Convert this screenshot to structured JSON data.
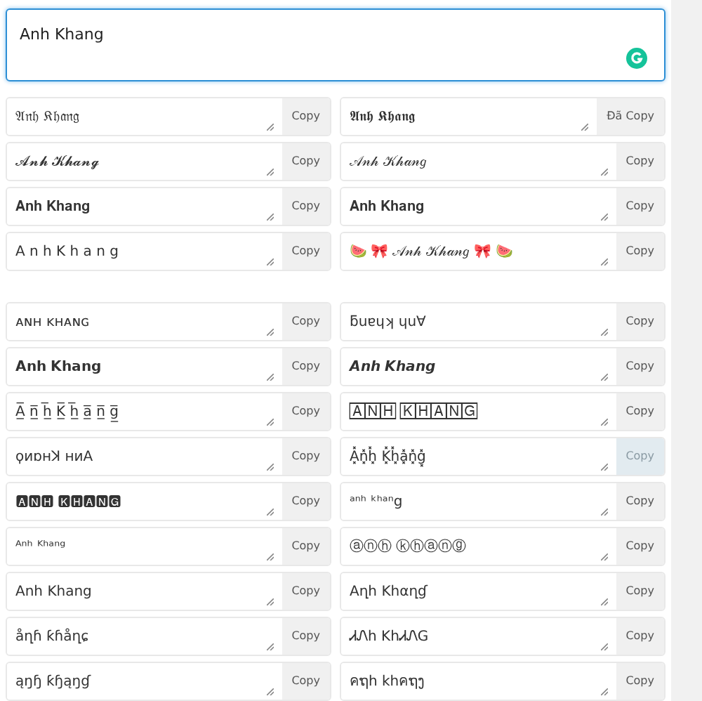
{
  "input": {
    "value": "Anh Khang"
  },
  "groups": [
    {
      "rows": [
        [
          {
            "text": "𝔄𝔫𝔥 𝔎𝔥𝔞𝔫𝔤",
            "button": "Copy",
            "highlighted": false
          },
          {
            "text": "𝕬𝖓𝖍 𝕶𝖍𝖆𝖓𝖌",
            "button": "Đã Copy",
            "highlighted": false
          }
        ],
        [
          {
            "text": "𝓐𝓷𝓱 𝓚𝓱𝓪𝓷𝓰",
            "button": "Copy",
            "highlighted": false
          },
          {
            "text": "𝒜𝓃𝒽 𝒦𝒽𝒶𝓃𝑔",
            "button": "Copy",
            "highlighted": false
          }
        ],
        [
          {
            "text": "𝐀𝐧𝐡 𝐊𝐡𝐚𝐧𝐠",
            "button": "Copy",
            "highlighted": false
          },
          {
            "text": "𝐀𝐧𝐡 𝐊𝐡𝐚𝐧𝐠",
            "button": "Copy",
            "highlighted": false
          }
        ],
        [
          {
            "text": "A n h  K h a n g",
            "button": "Copy",
            "highlighted": false
          },
          {
            "text": "🍉 🎀 𝒜𝓃𝒽 𝒦𝒽𝒶𝓃𝑔 🎀 🍉",
            "button": "Copy",
            "highlighted": false
          }
        ]
      ]
    },
    {
      "rows": [
        [
          {
            "text": "ᴀɴʜ ᴋʜᴀɴɢ",
            "button": "Copy",
            "highlighted": false
          },
          {
            "text": "ƃuɐɥʞ ɥu∀",
            "button": "Copy",
            "highlighted": false
          }
        ],
        [
          {
            "text": "𝗔𝗻𝗵 𝗞𝗵𝗮𝗻𝗴",
            "button": "Copy",
            "highlighted": false
          },
          {
            "text": "𝘼𝙣𝙝 𝙆𝙝𝙖𝙣𝙜",
            "button": "Copy",
            "highlighted": false
          }
        ],
        [
          {
            "text": "A̲̅ n̲̅ h̲̅  K̲̅ h̲̅ a̲̅ n̲̅ g̲̅",
            "button": "Copy",
            "highlighted": false
          },
          {
            "text": "🄰🄽🄷 🄺🄷🄰🄽🄶",
            "button": "Copy",
            "highlighted": false
          }
        ],
        [
          {
            "text": "ϙиɒнꓘ ниA",
            "button": "Copy",
            "highlighted": false
          },
          {
            "text": "A͓̽n͓̽h͓̽ K͓̽h͓̽a͓̽n͓̽g͓̽",
            "button": "Copy",
            "highlighted": true
          }
        ],
        [
          {
            "text": "🅰🅽🅷 🅺🅷🅰🅽🅶",
            "button": "Copy",
            "highlighted": false
          },
          {
            "text": "ᵃⁿʰ ᵏʰᵃⁿg",
            "button": "Copy",
            "highlighted": false
          }
        ],
        [
          {
            "text": "ᴬⁿʰ ᴷʰᵃⁿᵍ",
            "button": "Copy",
            "highlighted": false
          },
          {
            "text": "ⓐⓝⓗ ⓚⓗⓐⓝⓖ",
            "button": "Copy",
            "highlighted": false
          }
        ],
        [
          {
            "text": "Anh Khang",
            "button": "Copy",
            "highlighted": false
          },
          {
            "text": "Aղհ Kհαղɠ",
            "button": "Copy",
            "highlighted": false
          }
        ],
        [
          {
            "text": "åղɦ ƙɦåղɕ",
            "button": "Copy",
            "highlighted": false
          },
          {
            "text": "ᏗᏁh KhᏗᏁG",
            "button": "Copy",
            "highlighted": false
          }
        ],
        [
          {
            "text": "ąŋɧ ƙɧąŋɠ",
            "button": "Copy",
            "highlighted": false
          },
          {
            "text": "คຖh khคຖງ",
            "button": "Copy",
            "highlighted": false
          }
        ]
      ]
    }
  ]
}
